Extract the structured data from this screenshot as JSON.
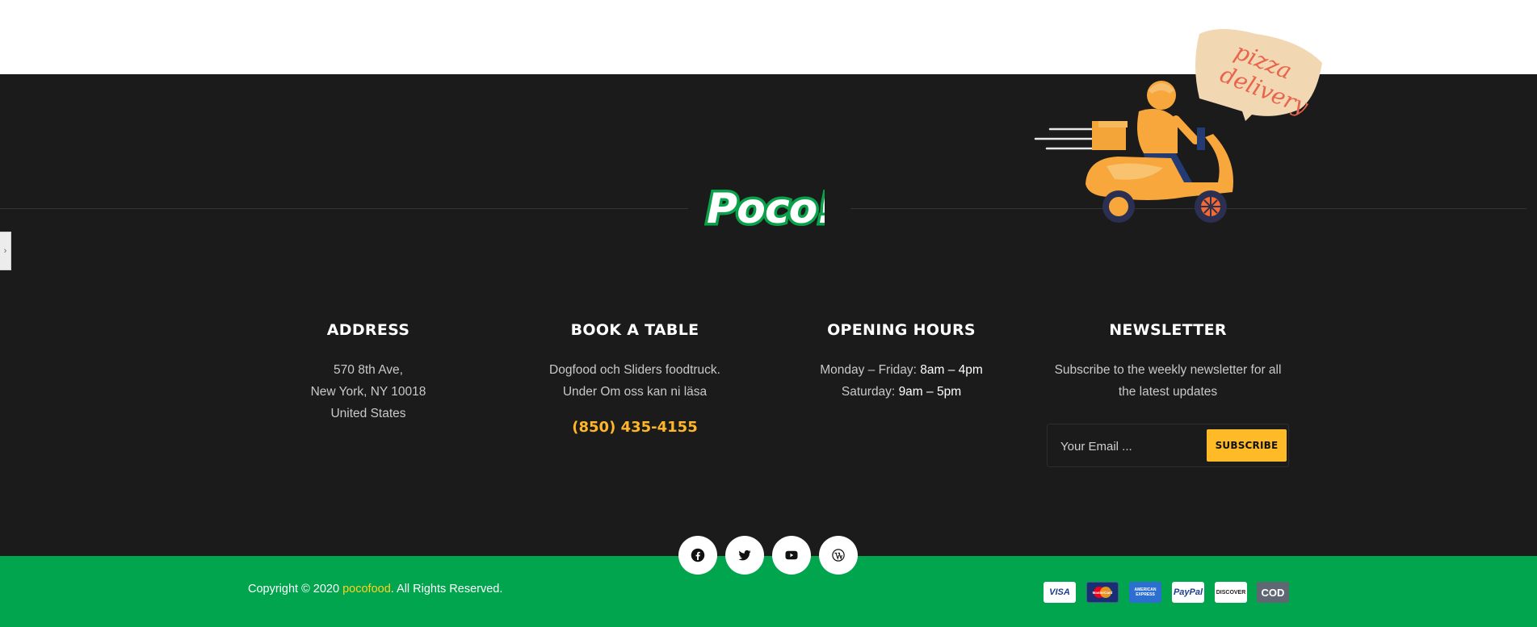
{
  "logo": {
    "text": "Poco!"
  },
  "promo": {
    "line1": "pizza",
    "line2": "delivery"
  },
  "columns": {
    "address": {
      "title": "ADDRESS",
      "line1": "570 8th Ave,",
      "line2": "New York, NY 10018",
      "line3": "United States"
    },
    "book": {
      "title": "BOOK A TABLE",
      "line1": "Dogfood och Sliders foodtruck.",
      "line2": "Under Om oss kan ni läsa",
      "phone": "(850) 435-4155"
    },
    "hours": {
      "title": "OPENING HOURS",
      "weekday_label": "Monday – Friday:",
      "weekday_time": "8am – 4pm",
      "saturday_label": "Saturday:",
      "saturday_time": "9am – 5pm"
    },
    "newsletter": {
      "title": "NEWSLETTER",
      "line1": "Subscribe to the weekly newsletter for all",
      "line2": "the latest updates",
      "placeholder": "Your Email ...",
      "button": "SUBSCRIBE"
    }
  },
  "social": [
    "facebook-icon",
    "twitter-icon",
    "youtube-icon",
    "wordpress-icon"
  ],
  "copyright": {
    "prefix": "Copyright © 2020 ",
    "brand": "pocofood",
    "suffix": ". All Rights Reserved."
  },
  "payments": {
    "visa": "VISA",
    "mastercard": "MasterCard",
    "amex": "AMERICAN EXPRESS",
    "paypal": "PayPal",
    "discover": "DISCOVER",
    "cod": "COD"
  },
  "colors": {
    "dark": "#1b1b1b",
    "green": "#00a54e",
    "yellow": "#ffbb27",
    "accent": "#ffd21f"
  }
}
